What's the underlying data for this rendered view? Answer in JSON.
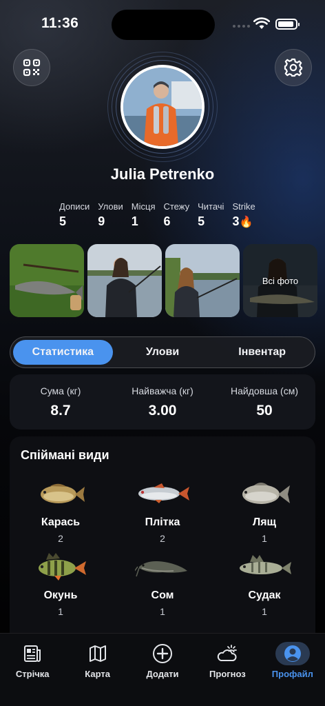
{
  "status_bar": {
    "time": "11:36"
  },
  "header": {
    "qr_icon": "qr-code-icon",
    "settings_icon": "gear-icon"
  },
  "profile": {
    "name": "Julia Petrenko",
    "stats": [
      {
        "label": "Дописи",
        "value": "5"
      },
      {
        "label": "Улови",
        "value": "9"
      },
      {
        "label": "Місця",
        "value": "1"
      },
      {
        "label": "Стежу",
        "value": "6"
      },
      {
        "label": "Читачі",
        "value": "5"
      },
      {
        "label": "Strike",
        "value": "3"
      }
    ],
    "strike_icon": "flame-icon"
  },
  "photos": {
    "all_label": "Всі фото"
  },
  "tabs": [
    {
      "label": "Статистика",
      "active": true
    },
    {
      "label": "Улови",
      "active": false
    },
    {
      "label": "Інвентар",
      "active": false
    }
  ],
  "summary": [
    {
      "label": "Сума (кг)",
      "value": "8.7"
    },
    {
      "label": "Найважча (кг)",
      "value": "3.00"
    },
    {
      "label": "Найдовша (см)",
      "value": "50"
    }
  ],
  "species": {
    "title": "Спіймані види",
    "items": [
      {
        "name": "Карась",
        "count": "2"
      },
      {
        "name": "Плітка",
        "count": "2"
      },
      {
        "name": "Лящ",
        "count": "1"
      },
      {
        "name": "Окунь",
        "count": "1"
      },
      {
        "name": "Сом",
        "count": "1"
      },
      {
        "name": "Судак",
        "count": "1"
      }
    ]
  },
  "nav": [
    {
      "label": "Стрічка",
      "icon": "newspaper-icon"
    },
    {
      "label": "Карта",
      "icon": "map-icon"
    },
    {
      "label": "Додати",
      "icon": "plus-circle-icon"
    },
    {
      "label": "Прогноз",
      "icon": "weather-icon"
    },
    {
      "label": "Профайл",
      "icon": "profile-icon",
      "active": true
    }
  ],
  "colors": {
    "accent": "#4a93ee",
    "strike": "#ff7a1a"
  }
}
